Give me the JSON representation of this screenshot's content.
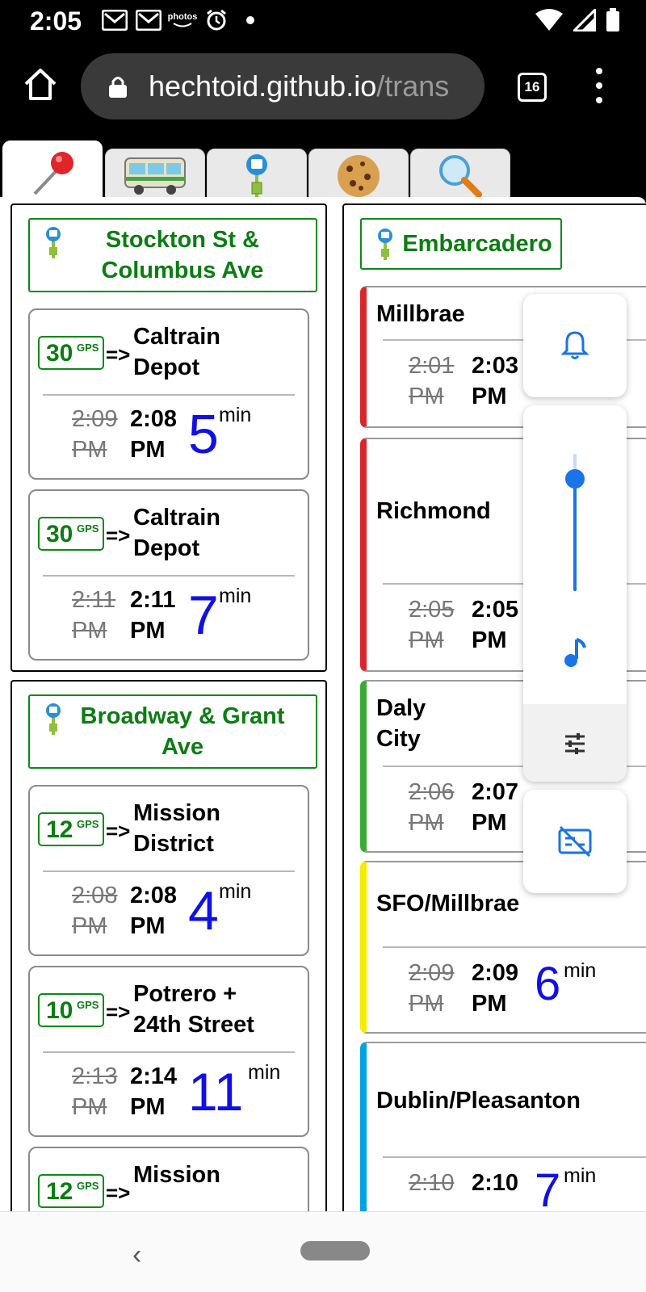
{
  "status_bar": {
    "time": "2:05",
    "notification_icons": [
      "gmail-icon",
      "gmail-icon",
      "amazon-photos-icon",
      "alarm-icon",
      "dot-icon"
    ],
    "photos_label": "photos",
    "right_icons": [
      "wifi-icon",
      "signal-icon",
      "battery-icon"
    ]
  },
  "browser": {
    "url_host": "hechtoid.github.io",
    "url_path": "/trans",
    "tab_count": "16"
  },
  "tabs": [
    {
      "icon": "round-pushpin",
      "glyph": "📍",
      "active": true
    },
    {
      "icon": "bus",
      "glyph": "🚌",
      "active": false
    },
    {
      "icon": "bus-stop",
      "glyph": "",
      "active": false
    },
    {
      "icon": "cookie",
      "glyph": "🍪",
      "active": false
    },
    {
      "icon": "magnifying-glass",
      "glyph": "🔍",
      "active": false
    }
  ],
  "muni_stops": [
    {
      "name": "Stockton St & Columbus Ave",
      "name_lines": [
        "Stockton St &",
        "Columbus Ave"
      ],
      "arrivals": [
        {
          "route": "30",
          "gps": "GPS",
          "arrow": "=>",
          "dest_lines": [
            "Caltrain",
            "Depot"
          ],
          "sched_lines": [
            "2:09",
            "PM"
          ],
          "pred_lines": [
            "2:08",
            "PM"
          ],
          "minutes": "5",
          "unit": "min"
        },
        {
          "route": "30",
          "gps": "GPS",
          "arrow": "=>",
          "dest_lines": [
            "Caltrain",
            "Depot"
          ],
          "sched_lines": [
            "2:11",
            "PM"
          ],
          "pred_lines": [
            "2:11",
            "PM"
          ],
          "minutes": "7",
          "unit": "min"
        }
      ]
    },
    {
      "name": "Broadway & Grant Ave",
      "name_lines": [
        "Broadway & Grant",
        "Ave"
      ],
      "arrivals": [
        {
          "route": "12",
          "gps": "GPS",
          "arrow": "=>",
          "dest_lines": [
            "Mission",
            "District"
          ],
          "sched_lines": [
            "2:08",
            "PM"
          ],
          "pred_lines": [
            "2:08",
            "PM"
          ],
          "minutes": "4",
          "unit": "min"
        },
        {
          "route": "10",
          "gps": "GPS",
          "arrow": "=>",
          "dest_lines": [
            "Potrero +",
            "24th Street"
          ],
          "sched_lines": [
            "2:13",
            "PM"
          ],
          "pred_lines": [
            "2:14",
            "PM"
          ],
          "minutes": "11",
          "unit": "min"
        },
        {
          "route": "12",
          "gps": "GPS",
          "arrow": "=>",
          "dest_lines": [
            "Mission",
            ""
          ],
          "sched_lines": [
            "",
            ""
          ],
          "pred_lines": [
            "",
            ""
          ],
          "minutes": "",
          "unit": ""
        }
      ]
    }
  ],
  "bart": {
    "station": "Embarcadero",
    "departures": [
      {
        "dest_lines": [
          "Millbrae",
          ""
        ],
        "line_color": "#d9262c",
        "sched_lines": [
          "2:01",
          "PM"
        ],
        "pred_lines": [
          "2:03",
          "PM"
        ],
        "minutes": "",
        "unit": ""
      },
      {
        "dest_lines": [
          "Richmond",
          ""
        ],
        "line_color": "#d9262c",
        "sched_lines": [
          "2:05",
          "PM"
        ],
        "pred_lines": [
          "2:05",
          "PM"
        ],
        "minutes": "",
        "unit": ""
      },
      {
        "dest_lines": [
          "Daly",
          "City"
        ],
        "line_color": "#3aaa35",
        "sched_lines": [
          "2:06",
          "PM"
        ],
        "pred_lines": [
          "2:07",
          "PM"
        ],
        "minutes": "",
        "unit": ""
      },
      {
        "dest_lines": [
          "SFO/Millbrae",
          ""
        ],
        "line_color": "#f5ec00",
        "sched_lines": [
          "2:09",
          "PM"
        ],
        "pred_lines": [
          "2:09",
          "PM"
        ],
        "minutes": "6",
        "unit": "min"
      },
      {
        "dest_lines": [
          "Dublin/Pleasanton",
          ""
        ],
        "line_color": "#00a3e0",
        "sched_lines": [
          "2:10",
          ""
        ],
        "pred_lines": [
          "2:10",
          ""
        ],
        "minutes": "7",
        "unit": "min"
      }
    ]
  },
  "volume_panel": {
    "accent": "#1a73e8",
    "level": 0.82,
    "icons": [
      "bell-icon",
      "music-note-icon",
      "tune-icon",
      "captions-off-icon"
    ]
  },
  "nav_bar": {
    "back_icon": "‹"
  }
}
